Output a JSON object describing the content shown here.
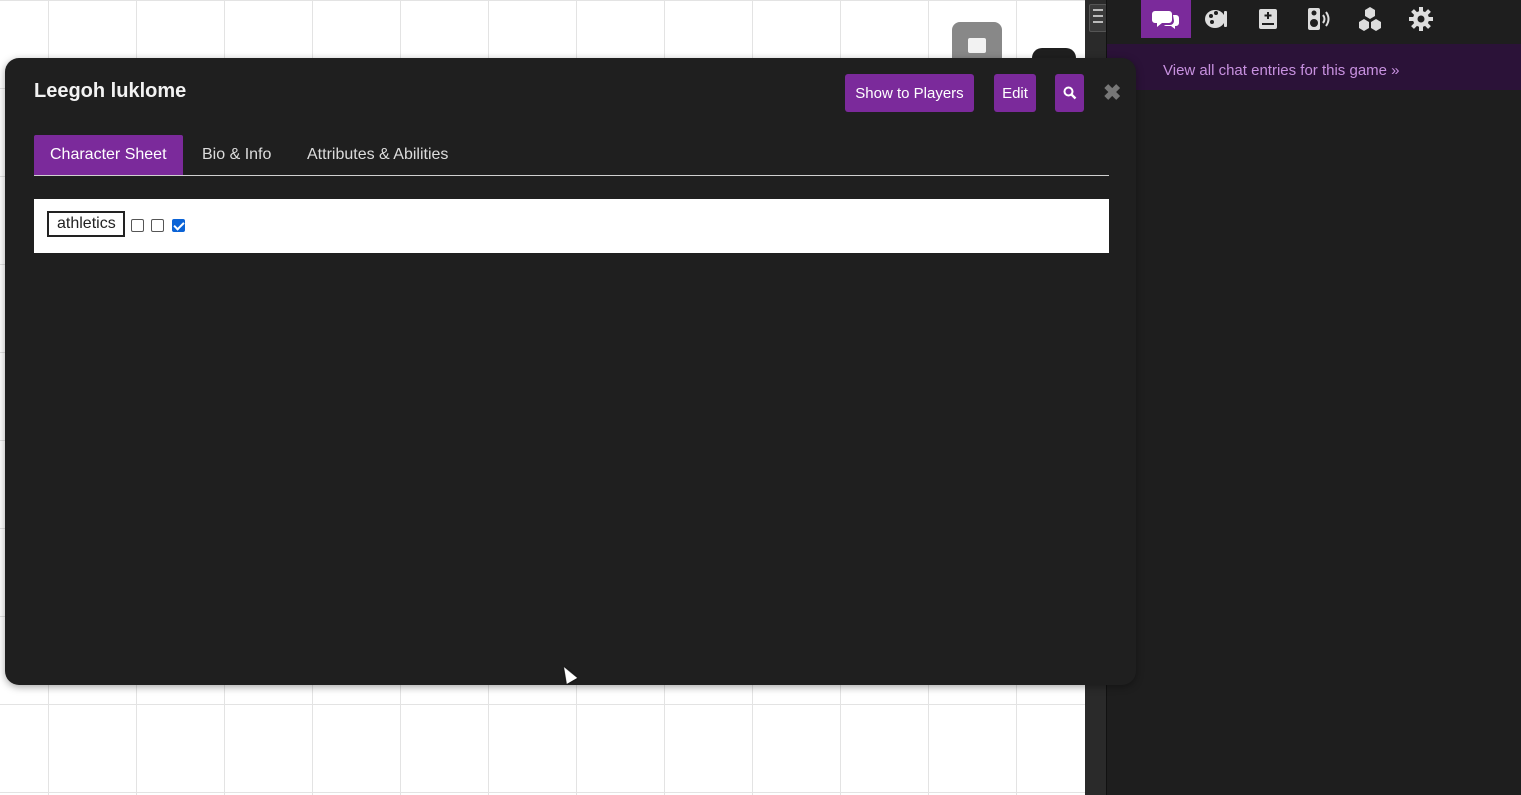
{
  "sidebar": {
    "tabs": [
      {
        "icon": "chat-icon"
      },
      {
        "icon": "art-library-icon"
      },
      {
        "icon": "journal-icon"
      },
      {
        "icon": "jukebox-icon"
      },
      {
        "icon": "collections-icon"
      },
      {
        "icon": "settings-icon"
      }
    ],
    "chat_link": "View all chat entries for this game »"
  },
  "dialog": {
    "title": "Leegoh luklome",
    "buttons": {
      "show_to_players": "Show to Players",
      "edit": "Edit"
    },
    "tabs": [
      {
        "label": "Character Sheet",
        "active": true
      },
      {
        "label": "Bio & Info",
        "active": false
      },
      {
        "label": "Attributes & Abilities",
        "active": false
      }
    ],
    "sheet": {
      "attribute_label": "athletics",
      "checkboxes": [
        false,
        false,
        true
      ]
    }
  },
  "colors": {
    "accent": "#7b2a9b",
    "dialog_bg": "#1f1f1f",
    "sidebar_bg": "#1e1e1e"
  }
}
